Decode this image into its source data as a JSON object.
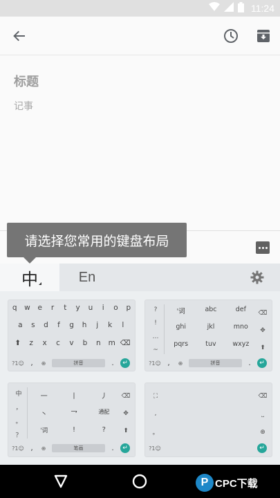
{
  "status": {
    "time": "11:24"
  },
  "note": {
    "title_placeholder": "标题",
    "body_placeholder": "记事"
  },
  "tooltip": {
    "text": "请选择您常用的键盘布局"
  },
  "keyboard": {
    "tab_zh": "中",
    "tab_en": "En",
    "qwerty": {
      "row1": [
        "q",
        "w",
        "e",
        "r",
        "t",
        "y",
        "u",
        "i",
        "o",
        "p"
      ],
      "row2": [
        "a",
        "s",
        "d",
        "f",
        "g",
        "h",
        "j",
        "k",
        "l"
      ],
      "row3": [
        "z",
        "x",
        "c",
        "v",
        "b",
        "n",
        "m"
      ],
      "mode": "?1☺",
      "comma": ",",
      "space": "拼音"
    },
    "t9": {
      "side": [
        "?",
        "!",
        "…",
        "~"
      ],
      "row1": [
        "'词",
        "abc",
        "def"
      ],
      "row2": [
        "ghi",
        "jkl",
        "mno"
      ],
      "row3": [
        "pqrs",
        "tuv",
        "wxyz"
      ],
      "mode": "?1☺",
      "comma": ",",
      "space": "拼音"
    },
    "stroke": {
      "side": [
        "中",
        "，",
        "。",
        "？"
      ],
      "row1": [
        "一",
        "丨",
        "丿"
      ],
      "row2": [
        "丶",
        "乛",
        "通配"
      ],
      "row3": [
        "'词",
        "!",
        "?"
      ],
      "mode": "?1☺",
      "comma": ",",
      "space": "笔画"
    },
    "handwriting": {
      "mode": "?1☺",
      "comma": ",",
      "dot": "。"
    }
  },
  "watermark": {
    "letter": "P",
    "text": "CPC下载"
  }
}
